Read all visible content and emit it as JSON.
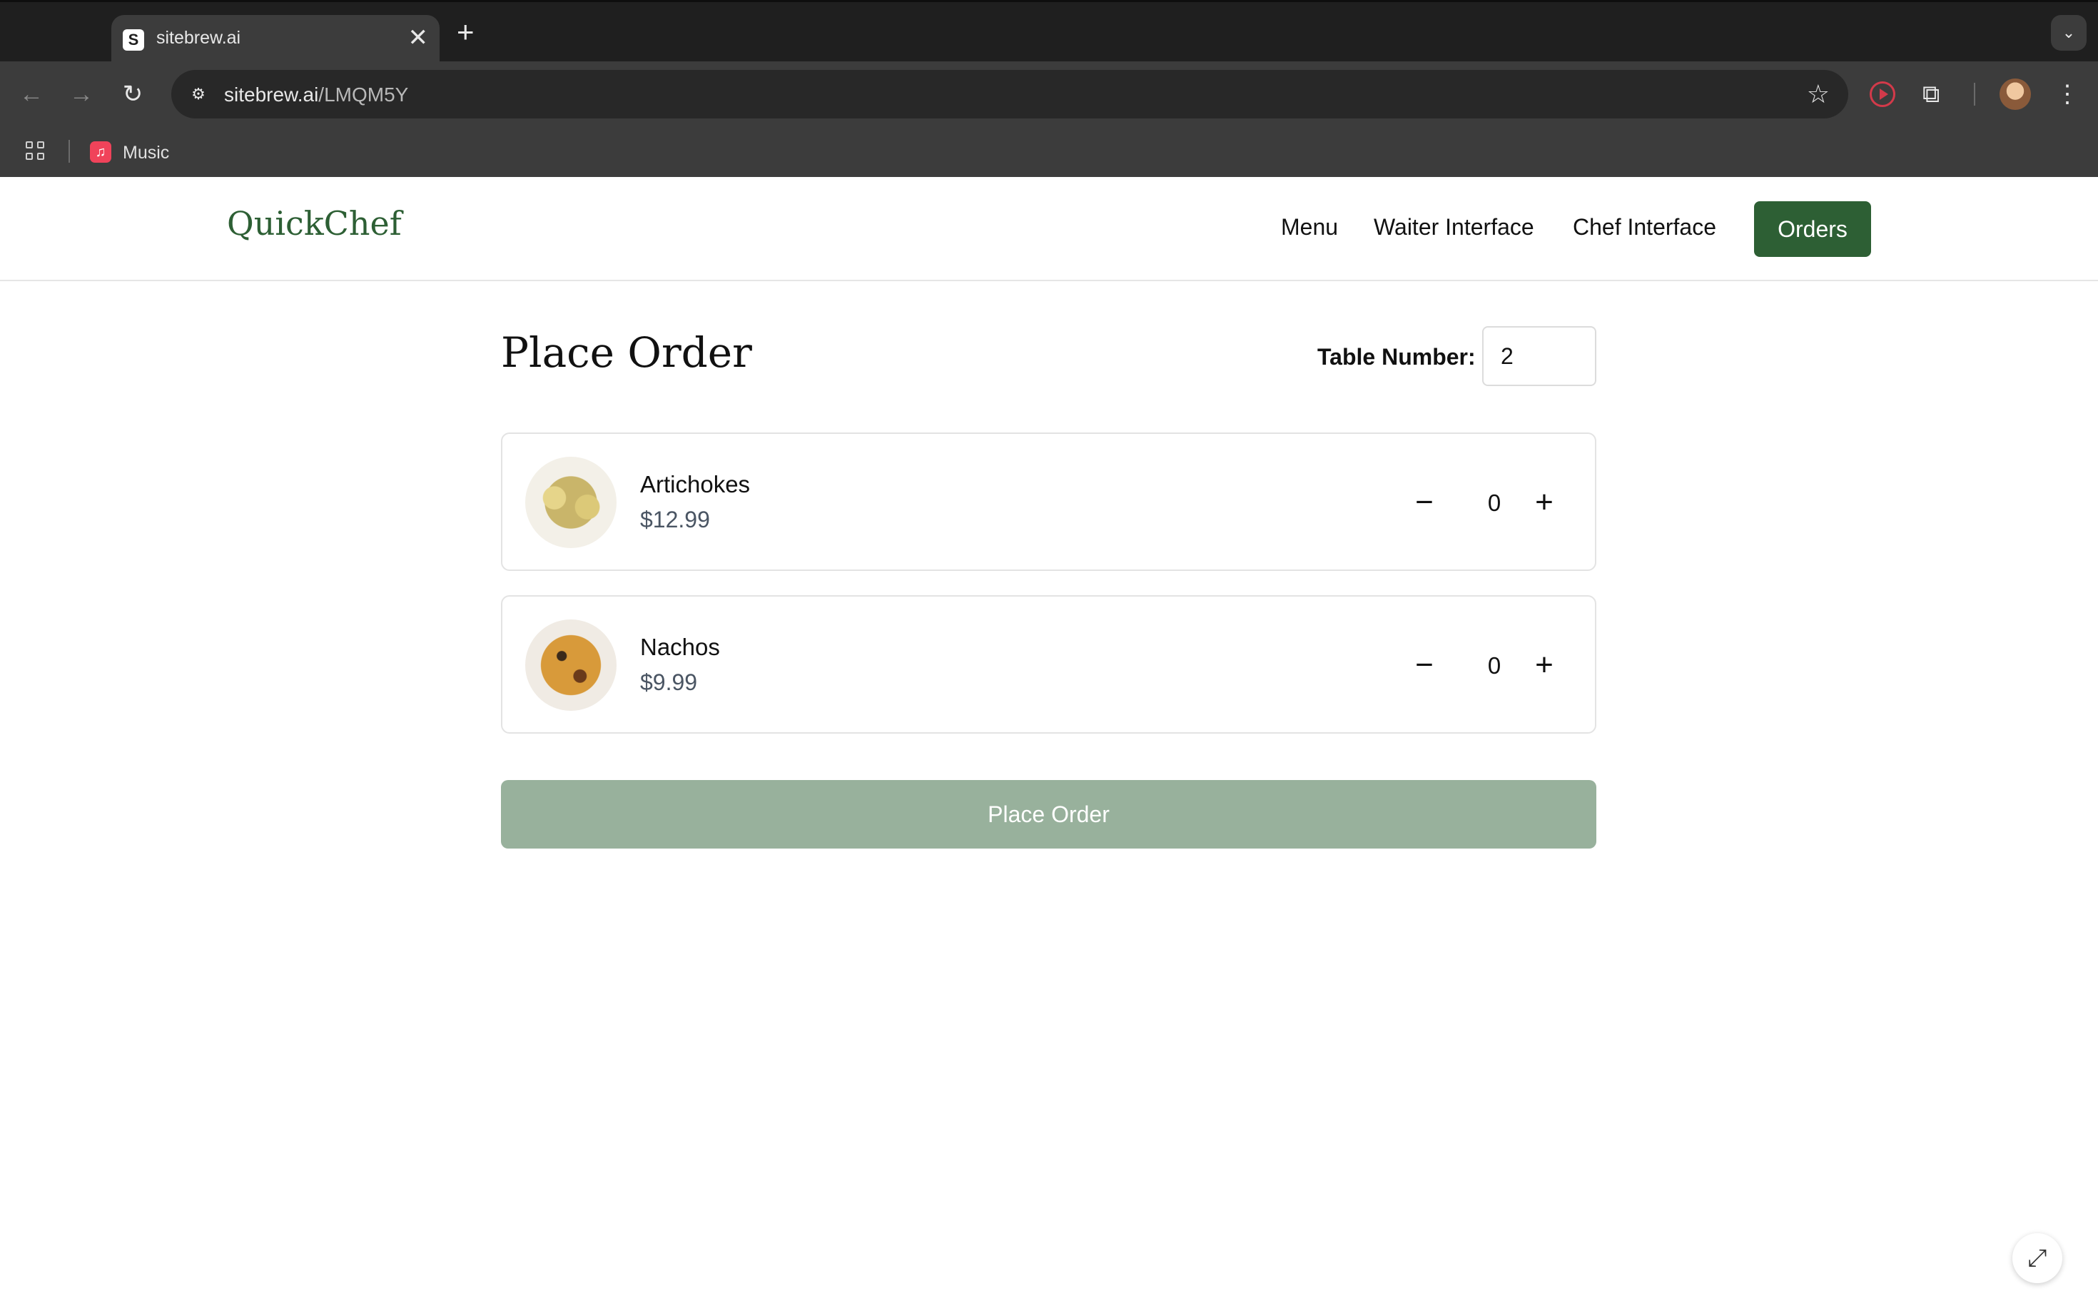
{
  "browser": {
    "tab_title": "sitebrew.ai",
    "tab_favicon": "S",
    "tab_close": "✕",
    "new_tab": "+",
    "url_host": "sitebrew.ai",
    "url_path": "/LMQM5Y",
    "bookmarks": [
      {
        "label": "Music",
        "icon": "music-icon"
      }
    ]
  },
  "header": {
    "logo": "QuickChef",
    "nav": [
      "Menu",
      "Waiter Interface",
      "Chef Interface"
    ],
    "active_button": "Orders",
    "brand_color": "#2d5f34"
  },
  "page": {
    "title": "Place Order",
    "table_label": "Table Number:",
    "table_value": "2"
  },
  "items": [
    {
      "name": "Artichokes",
      "price": "$12.99",
      "quantity": "0"
    },
    {
      "name": "Nachos",
      "price": "$9.99",
      "quantity": "0"
    }
  ],
  "controls": {
    "minus": "−",
    "plus": "+"
  },
  "place_order_label": "Place Order",
  "place_order_color": "#98b19c"
}
